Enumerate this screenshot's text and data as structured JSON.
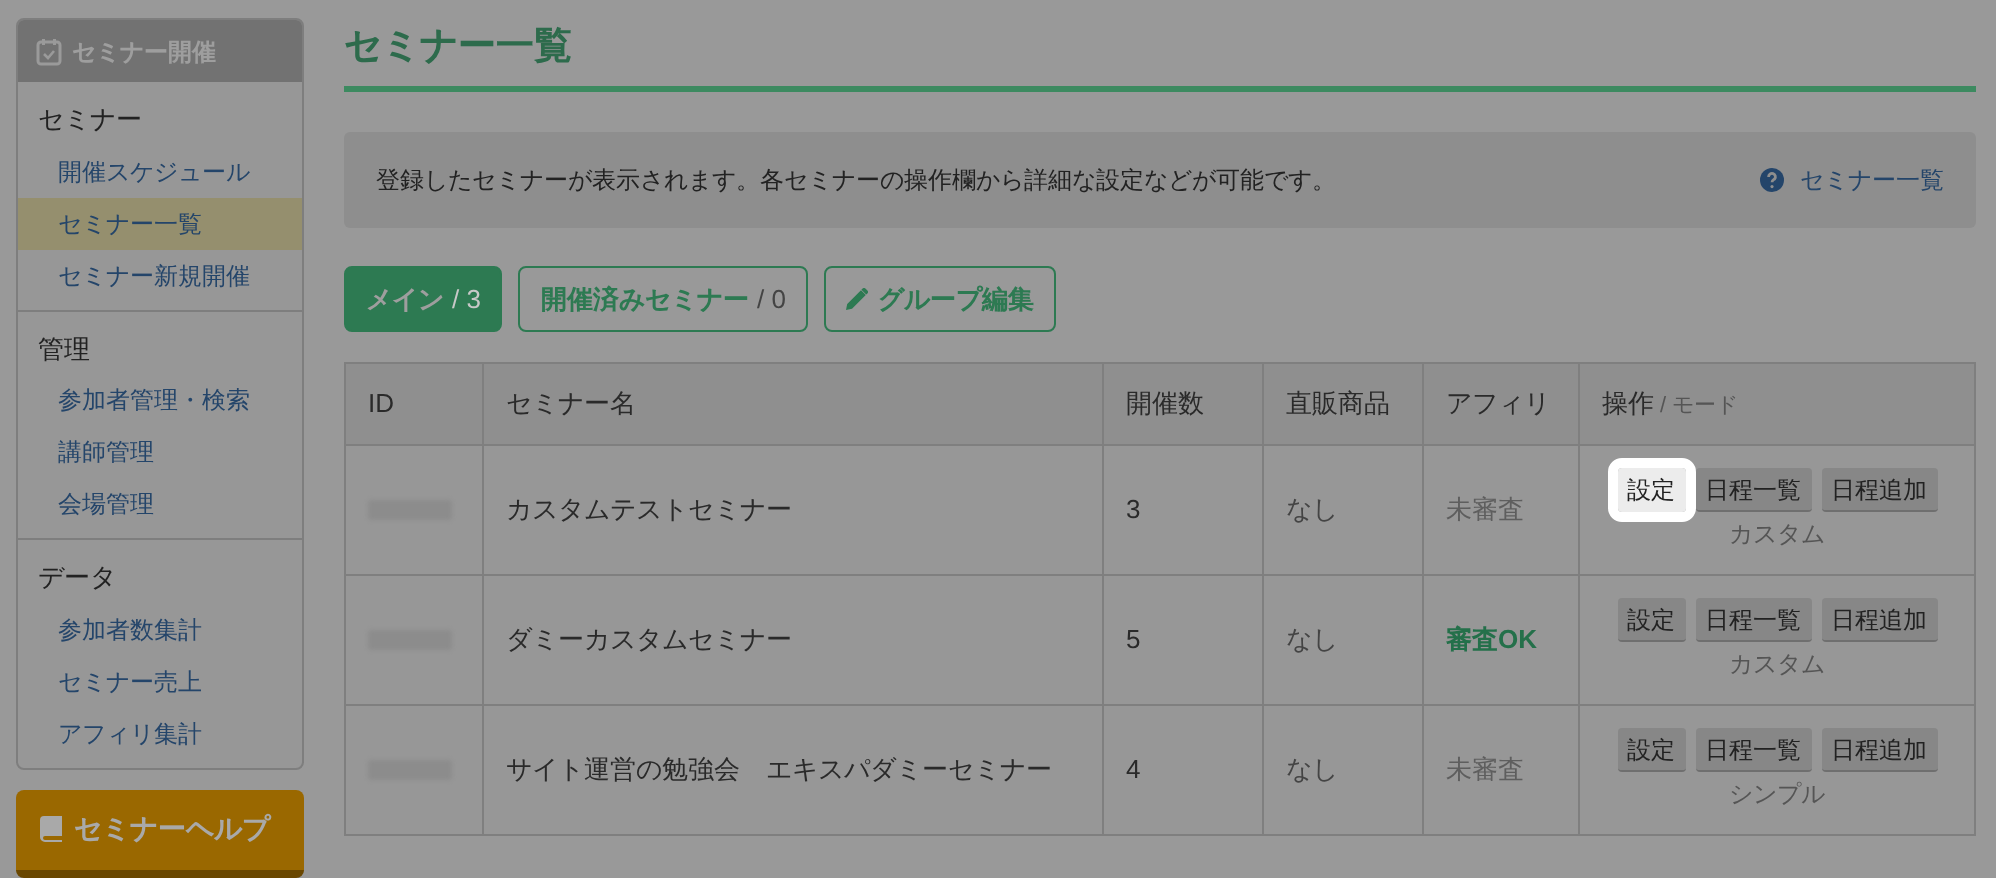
{
  "sidebar": {
    "title": "セミナー開催",
    "sections": [
      {
        "heading": "セミナー",
        "items": [
          {
            "label": "開催スケジュール",
            "selected": false
          },
          {
            "label": "セミナー一覧",
            "selected": true
          },
          {
            "label": "セミナー新規開催",
            "selected": false
          }
        ]
      },
      {
        "heading": "管理",
        "items": [
          {
            "label": "参加者管理・検索",
            "selected": false
          },
          {
            "label": "講師管理",
            "selected": false
          },
          {
            "label": "会場管理",
            "selected": false
          }
        ]
      },
      {
        "heading": "データ",
        "items": [
          {
            "label": "参加者数集計",
            "selected": false
          },
          {
            "label": "セミナー売上",
            "selected": false
          },
          {
            "label": "アフィリ集計",
            "selected": false
          }
        ]
      }
    ],
    "help_button": "セミナーヘルプ"
  },
  "page_title": "セミナー一覧",
  "info": {
    "text": "登録したセミナーが表示されます。各セミナーの操作欄から詳細な設定などが可能です。",
    "help_link": "セミナー一覧"
  },
  "tabs": [
    {
      "label": "メイン",
      "count": "/ 3",
      "selected": true
    },
    {
      "label": "開催済みセミナー",
      "count": "/ 0",
      "selected": false
    }
  ],
  "group_edit_button": "グループ編集",
  "table": {
    "columns": [
      "ID",
      "セミナー名",
      "開催数",
      "直販商品",
      "アフィリ",
      "操作"
    ],
    "action_column_suffix": "/ モード",
    "rows": [
      {
        "name": "カスタムテストセミナー",
        "count": "3",
        "direct_product": "なし",
        "affiliate": {
          "text": "未審査",
          "kind": "pending"
        },
        "actions": [
          {
            "label": "設定",
            "highlighted": true
          },
          {
            "label": "日程一覧",
            "highlighted": false
          },
          {
            "label": "日程追加",
            "highlighted": false
          }
        ],
        "mode": "カスタム"
      },
      {
        "name": "ダミーカスタムセミナー",
        "count": "5",
        "direct_product": "なし",
        "affiliate": {
          "text": "審査OK",
          "kind": "approved"
        },
        "actions": [
          {
            "label": "設定",
            "highlighted": false
          },
          {
            "label": "日程一覧",
            "highlighted": false
          },
          {
            "label": "日程追加",
            "highlighted": false
          }
        ],
        "mode": "カスタム"
      },
      {
        "name": "サイト運営の勉強会　エキスパダミーセミナー",
        "count": "4",
        "direct_product": "なし",
        "affiliate": {
          "text": "未審査",
          "kind": "pending"
        },
        "actions": [
          {
            "label": "設定",
            "highlighted": false
          },
          {
            "label": "日程一覧",
            "highlighted": false
          },
          {
            "label": "日程追加",
            "highlighted": false
          }
        ],
        "mode": "シンプル"
      }
    ]
  }
}
